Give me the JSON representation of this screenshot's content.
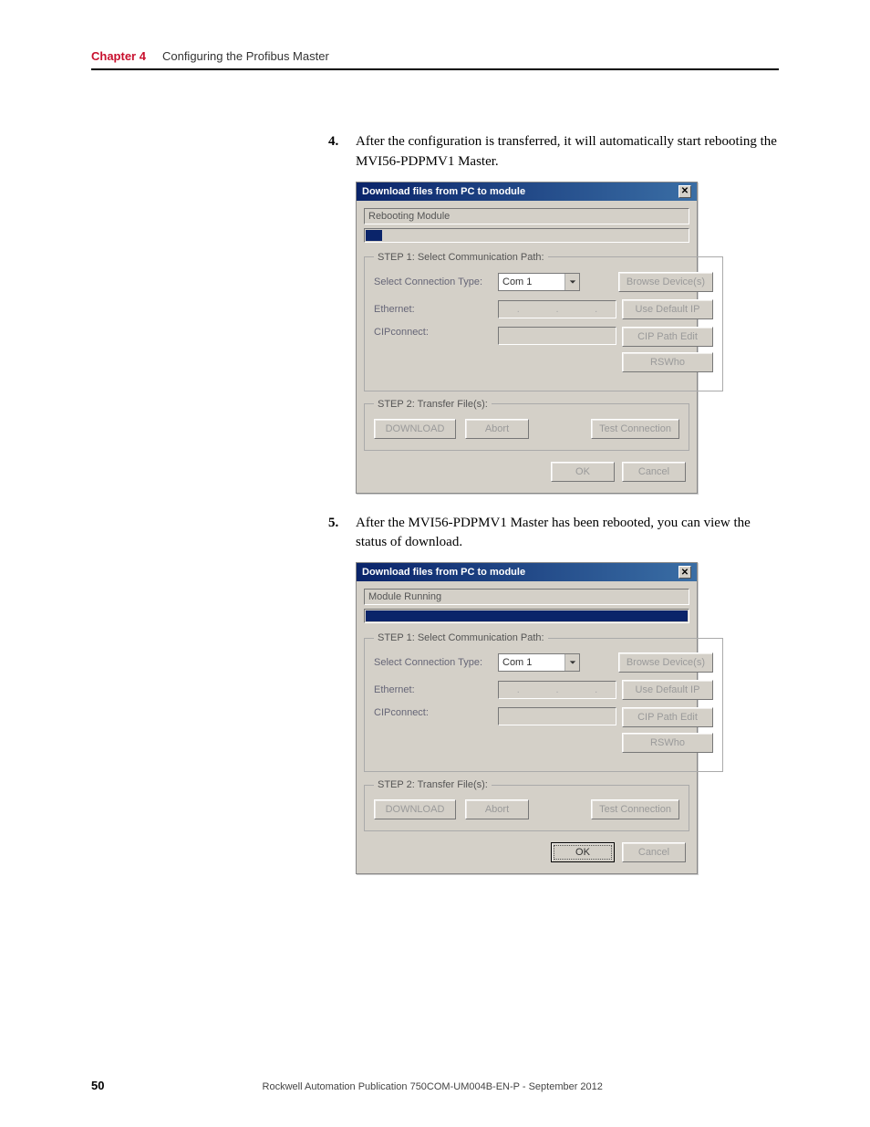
{
  "header": {
    "chapter_label": "Chapter 4",
    "chapter_title": "Configuring the Profibus Master"
  },
  "steps": {
    "s4": {
      "num": "4.",
      "text": "After the configuration is transferred, it will automatically start rebooting the MVI56-PDPMV1 Master."
    },
    "s5": {
      "num": "5.",
      "text": "After the MVI56-PDPMV1 Master has been rebooted, you can view the status of download."
    }
  },
  "dialog1": {
    "title": "Download files from PC to module",
    "status": "Rebooting Module",
    "step1_legend": "STEP 1: Select Communication Path:",
    "conn_type_label": "Select Connection Type:",
    "conn_type_value": "Com 1",
    "browse_btn": "Browse Device(s)",
    "ethernet_label": "Ethernet:",
    "ip_dots": ".   .   .",
    "default_ip_btn": "Use Default IP",
    "cip_label": "CIPconnect:",
    "cip_path_btn": "CIP Path Edit",
    "rswho_btn": "RSWho",
    "step2_legend": "STEP 2: Transfer File(s):",
    "download_btn": "DOWNLOAD",
    "abort_btn": "Abort",
    "test_btn": "Test Connection",
    "ok_btn": "OK",
    "cancel_btn": "Cancel"
  },
  "dialog2": {
    "title": "Download files from PC to module",
    "status": "Module Running",
    "step1_legend": "STEP 1: Select Communication Path:",
    "conn_type_label": "Select Connection Type:",
    "conn_type_value": "Com 1",
    "browse_btn": "Browse Device(s)",
    "ethernet_label": "Ethernet:",
    "ip_dots": ".   .   .",
    "default_ip_btn": "Use Default IP",
    "cip_label": "CIPconnect:",
    "cip_path_btn": "CIP Path Edit",
    "rswho_btn": "RSWho",
    "step2_legend": "STEP 2: Transfer File(s):",
    "download_btn": "DOWNLOAD",
    "abort_btn": "Abort",
    "test_btn": "Test Connection",
    "ok_btn": "OK",
    "cancel_btn": "Cancel"
  },
  "footer": {
    "page": "50",
    "publication": "Rockwell Automation Publication 750COM-UM004B-EN-P - September 2012"
  }
}
